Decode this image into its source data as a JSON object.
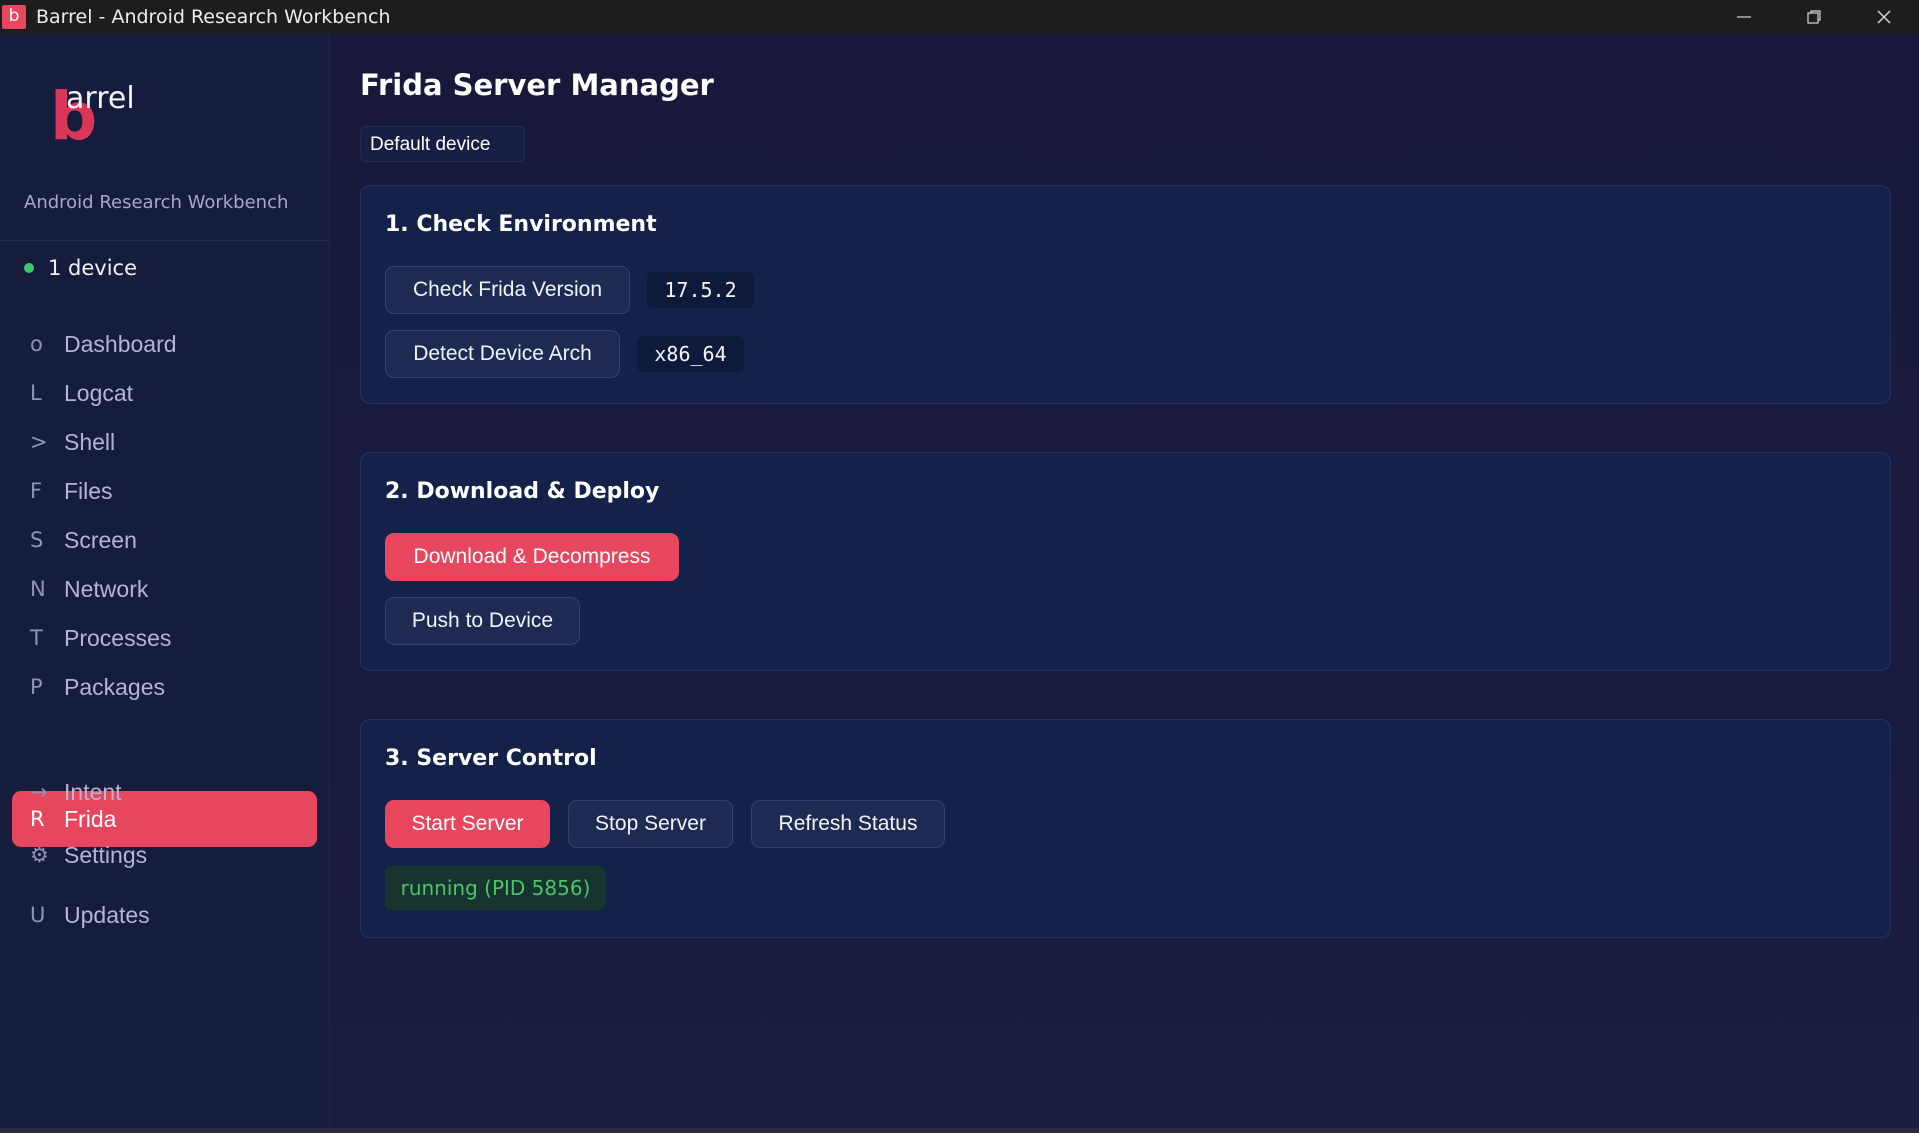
{
  "window": {
    "app_icon_letter": "b",
    "title": "Barrel - Android Research Workbench"
  },
  "sidebar": {
    "logo": {
      "initial": "b",
      "rest": "arrel"
    },
    "subtitle": "Android Research Workbench",
    "device_status": {
      "text": "1 device",
      "status_color": "#3ec46d"
    },
    "items": [
      {
        "glyph": "o",
        "label": "Dashboard",
        "active": false
      },
      {
        "glyph": "L",
        "label": "Logcat",
        "active": false
      },
      {
        "glyph": ">",
        "label": "Shell",
        "active": false
      },
      {
        "glyph": "F",
        "label": "Files",
        "active": false
      },
      {
        "glyph": "S",
        "label": "Screen",
        "active": false
      },
      {
        "glyph": "N",
        "label": "Network",
        "active": false
      },
      {
        "glyph": "T",
        "label": "Processes",
        "active": false
      },
      {
        "glyph": "P",
        "label": "Packages",
        "active": false
      },
      {
        "glyph": "R",
        "label": "Frida",
        "active": true
      },
      {
        "glyph": "→",
        "label": "Intent",
        "active": false
      },
      {
        "glyph": "⚙",
        "label": "Settings",
        "active": false
      },
      {
        "glyph": "U",
        "label": "Updates",
        "active": false
      }
    ]
  },
  "main": {
    "title": "Frida Server Manager",
    "device_select": {
      "selected": "Default device"
    },
    "sections": {
      "check": {
        "title": "1. Check Environment",
        "check_version_label": "Check Frida Version",
        "version_value": "17.5.2",
        "detect_arch_label": "Detect Device Arch",
        "arch_value": "x86_64"
      },
      "deploy": {
        "title": "2. Download & Deploy",
        "download_label": "Download & Decompress",
        "push_label": "Push to Device"
      },
      "control": {
        "title": "3. Server Control",
        "start_label": "Start Server",
        "stop_label": "Stop Server",
        "refresh_label": "Refresh Status",
        "status_text": "running (PID 5856)"
      }
    }
  },
  "colors": {
    "accent": "#e8455e",
    "running_status": "#4cc46b"
  }
}
